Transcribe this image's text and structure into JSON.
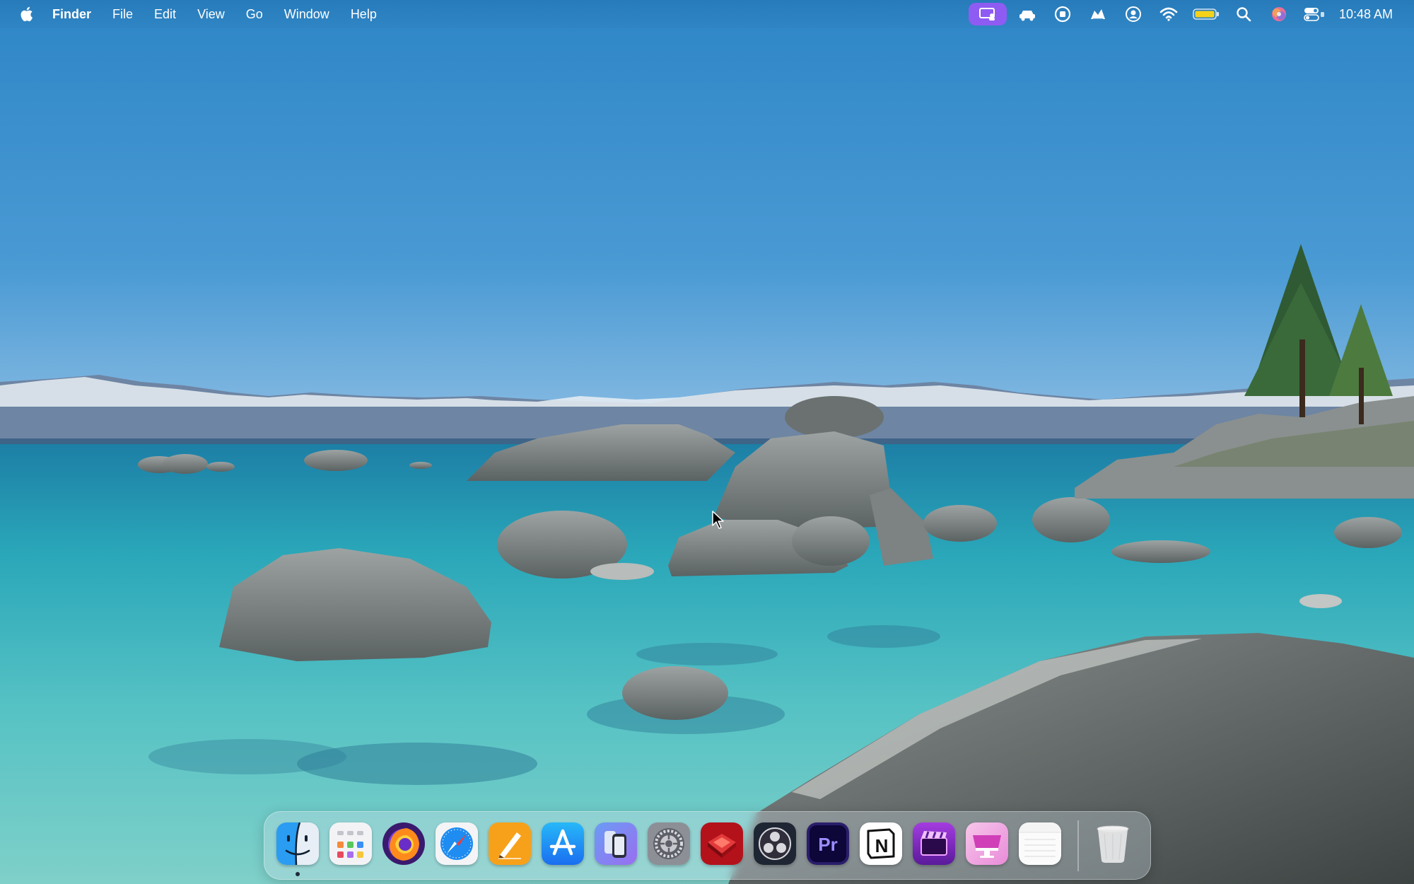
{
  "menubar": {
    "apple_icon": "apple-logo-icon",
    "app_name": "Finder",
    "items": [
      {
        "label": "File"
      },
      {
        "label": "Edit"
      },
      {
        "label": "View"
      },
      {
        "label": "Go"
      },
      {
        "label": "Window"
      },
      {
        "label": "Help"
      }
    ],
    "status_icons": [
      "screen-sharing-icon",
      "car-icon",
      "screen-record-icon",
      "ai-assistant-icon",
      "user-account-icon",
      "wifi-icon",
      "battery-icon",
      "spotlight-search-icon",
      "siri-icon",
      "control-center-icon"
    ],
    "clock": "10:48 AM",
    "accent_color": "#8e5cf2"
  },
  "dock": {
    "apps": [
      {
        "name": "Finder",
        "icon": "finder-icon",
        "running": true
      },
      {
        "name": "Launchpad",
        "icon": "launchpad-icon",
        "running": false
      },
      {
        "name": "Firefox",
        "icon": "firefox-icon",
        "running": false
      },
      {
        "name": "Safari",
        "icon": "safari-icon",
        "running": false
      },
      {
        "name": "Pages",
        "icon": "pages-icon",
        "running": false
      },
      {
        "name": "App Store",
        "icon": "app-store-icon",
        "running": false
      },
      {
        "name": "iPhone Mirroring",
        "icon": "iphone-mirroring-icon",
        "running": false
      },
      {
        "name": "System Settings",
        "icon": "system-settings-icon",
        "running": false
      },
      {
        "name": "Red App",
        "icon": "red-gem-app-icon",
        "running": false
      },
      {
        "name": "OBS",
        "icon": "obs-icon",
        "running": false
      },
      {
        "name": "Premiere Pro",
        "icon": "premiere-pro-icon",
        "running": false
      },
      {
        "name": "Notion",
        "icon": "notion-icon",
        "running": false
      },
      {
        "name": "Movie App",
        "icon": "clapper-app-icon",
        "running": false
      },
      {
        "name": "Display App",
        "icon": "pink-display-app-icon",
        "running": false
      },
      {
        "name": "Notes",
        "icon": "notes-icon",
        "running": false
      }
    ],
    "trash": {
      "name": "Trash",
      "icon": "trash-icon"
    },
    "premiere_label": "Pr",
    "notion_label": "N"
  }
}
